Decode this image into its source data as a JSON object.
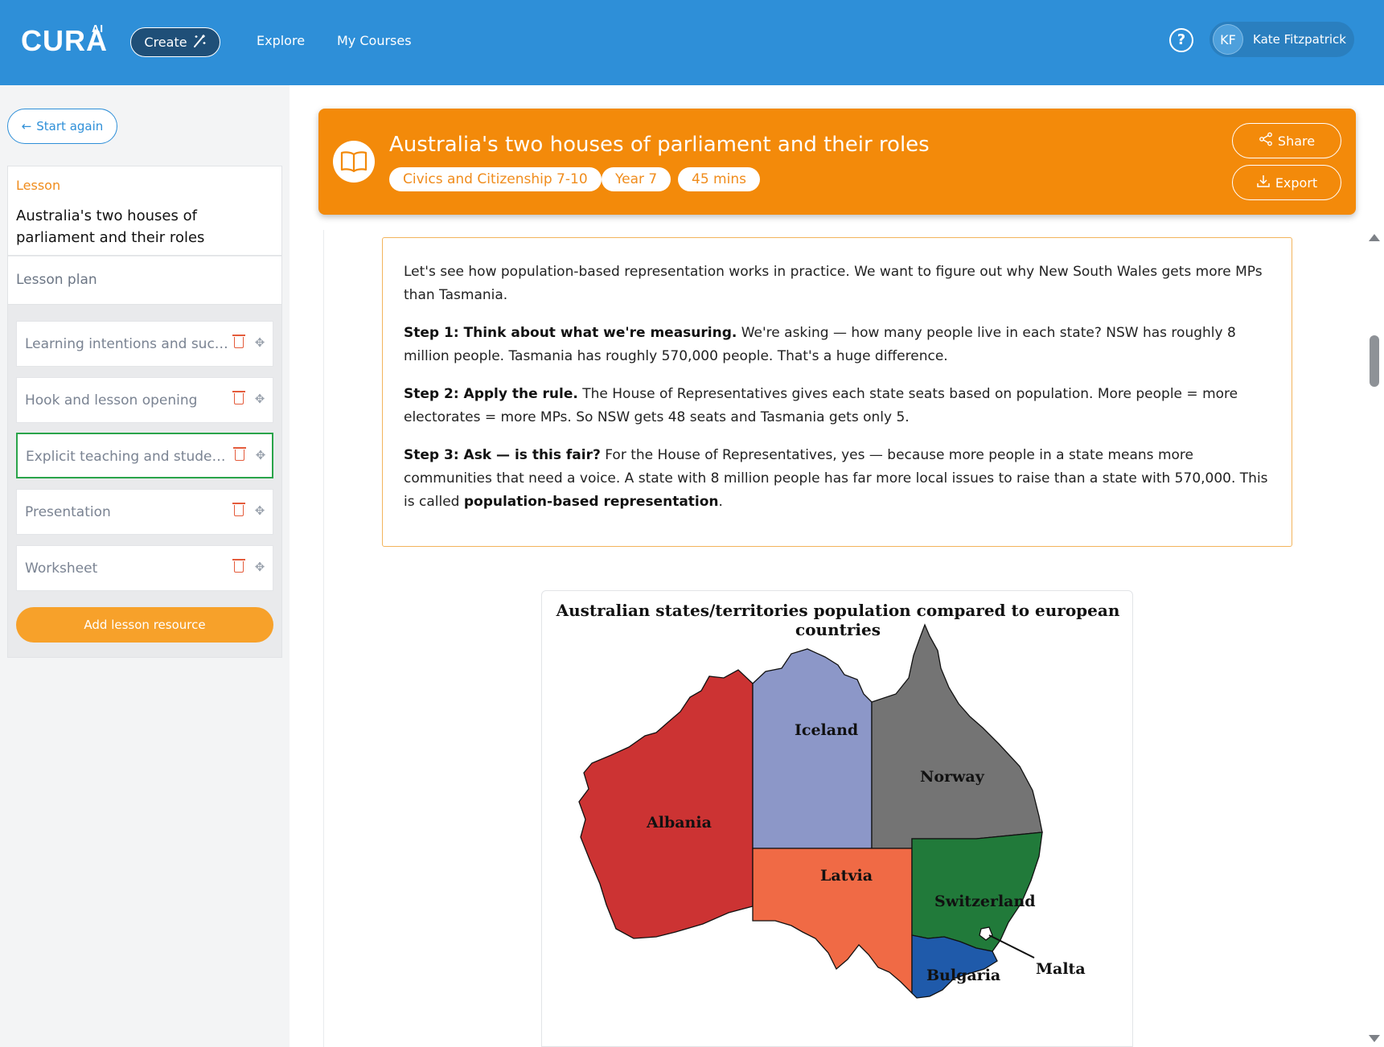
{
  "app": {
    "logo": "CURA",
    "logo_sup": "AI",
    "create_label": "Create",
    "nav": [
      "Explore",
      "My Courses"
    ],
    "help_icon": "help-circle-icon",
    "user": {
      "initials": "KF",
      "name": "Kate Fitzpatrick"
    }
  },
  "sidebar": {
    "start_again": "Start again",
    "lesson_label": "Lesson",
    "lesson_title": "Australia's two houses of parliament and their roles",
    "lesson_plan": "Lesson plan",
    "resources": [
      {
        "label": "Learning intentions and success criteria"
      },
      {
        "label": "Hook and lesson opening"
      },
      {
        "label": "Explicit teaching and student practice"
      },
      {
        "label": "Presentation"
      },
      {
        "label": "Worksheet"
      }
    ],
    "add_resource": "Add lesson resource"
  },
  "header": {
    "title": "Australia's two houses of parliament and their roles",
    "tags": [
      "Civics and Citizenship 7-10",
      "Year 7",
      "45 mins"
    ],
    "share": "Share",
    "export": "Export"
  },
  "content": {
    "intro": "Let's see how population-based representation works in practice. We want to figure out why New South Wales gets more MPs than Tasmania.",
    "step1_bold": "Step 1: Think about what we're measuring.",
    "step1_text": " We're asking — how many people live in each state? NSW has roughly 8 million people. Tasmania has roughly 570,000 people. That's a huge difference.",
    "step2_bold": "Step 2: Apply the rule.",
    "step2_text": " The House of Representatives gives each state seats based on population. More people = more electorates = more MPs. So NSW gets 48 seats and Tasmania gets only 5.",
    "step3_bold_a": "Step 3: Ask — is this fair?",
    "step3_text_a": " For the House of Representatives, yes — because more people in a state means more communities that need a voice. A state with 8 million people has far more local issues to raise than a state with 570,000. This is called ",
    "step3_bold_b": "population-based representation",
    "step3_text_b": "."
  },
  "map": {
    "title": "Australian states/territories population compared to european countries",
    "regions": [
      {
        "label": "Albania",
        "color": "#cc3333"
      },
      {
        "label": "Iceland",
        "color": "#8c97c8"
      },
      {
        "label": "Norway",
        "color": "#747474"
      },
      {
        "label": "Latvia",
        "color": "#f06a45"
      },
      {
        "label": "Switzerland",
        "color": "#217a3a"
      },
      {
        "label": "Bulgaria",
        "color": "#1f5aaa"
      },
      {
        "label": "Malta",
        "color": "#ffffff"
      }
    ]
  }
}
